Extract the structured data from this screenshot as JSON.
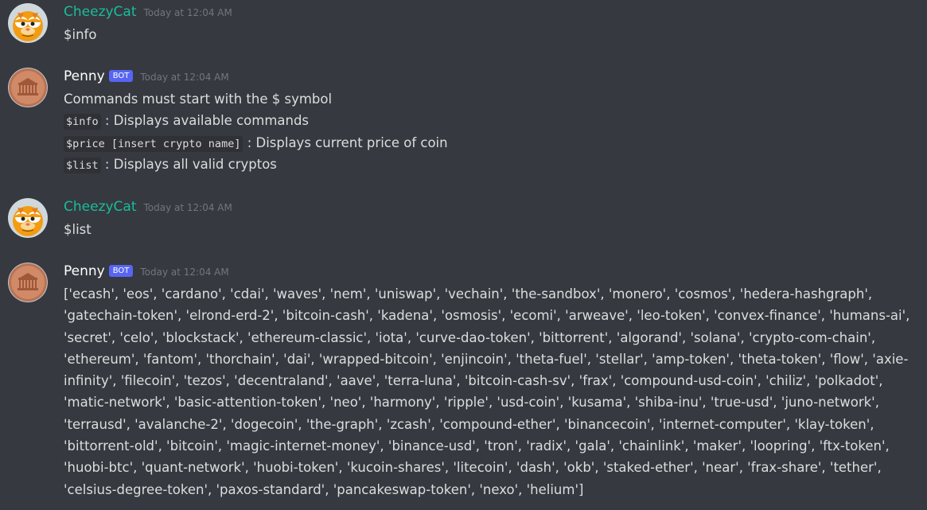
{
  "messages": [
    {
      "author": "CheezyCat",
      "timestamp": "Today at 12:04 AM",
      "content": "$info"
    },
    {
      "author": "Penny",
      "bot_tag": "BOT",
      "timestamp": "Today at 12:04 AM",
      "lines": [
        {
          "text": "Commands must start with the $ symbol"
        },
        {
          "code": "$info",
          "text": ": Displays available commands"
        },
        {
          "code": "$price [insert crypto name]",
          "text": ": Displays current price of coin"
        },
        {
          "code": "$list",
          "text": ": Displays all valid cryptos"
        }
      ]
    },
    {
      "author": "CheezyCat",
      "timestamp": "Today at 12:04 AM",
      "content": "$list"
    },
    {
      "author": "Penny",
      "bot_tag": "BOT",
      "timestamp": "Today at 12:04 AM",
      "content": "['ecash', 'eos', 'cardano', 'cdai', 'waves', 'nem', 'uniswap', 'vechain', 'the-sandbox', 'monero', 'cosmos', 'hedera-hashgraph', 'gatechain-token', 'elrond-erd-2', 'bitcoin-cash', 'kadena', 'osmosis', 'ecomi', 'arweave', 'leo-token', 'convex-finance', 'humans-ai', 'secret', 'celo', 'blockstack', 'ethereum-classic', 'iota', 'curve-dao-token', 'bittorrent', 'algorand', 'solana', 'crypto-com-chain', 'ethereum', 'fantom', 'thorchain', 'dai', 'wrapped-bitcoin', 'enjincoin', 'theta-fuel', 'stellar', 'amp-token', 'theta-token', 'flow', 'axie-infinity', 'filecoin', 'tezos', 'decentraland', 'aave', 'terra-luna', 'bitcoin-cash-sv', 'frax', 'compound-usd-coin', 'chiliz', 'polkadot', 'matic-network', 'basic-attention-token', 'neo', 'harmony', 'ripple', 'usd-coin', 'kusama', 'shiba-inu', 'true-usd', 'juno-network', 'terrausd', 'avalanche-2', 'dogecoin', 'the-graph', 'zcash', 'compound-ether', 'binancecoin', 'internet-computer', 'klay-token', 'bittorrent-old', 'bitcoin', 'magic-internet-money', 'binance-usd', 'tron', 'radix', 'gala', 'chainlink', 'maker', 'loopring', 'ftx-token', 'huobi-btc', 'quant-network', 'huobi-token', 'kucoin-shares', 'litecoin', 'dash', 'okb', 'staked-ether', 'near', 'frax-share', 'tether', 'celsius-degree-token', 'paxos-standard', 'pancakeswap-token', 'nexo', 'helium']"
    }
  ],
  "icons": {
    "cat_avatar": "garfield-avatar-icon",
    "bot_avatar": "penny-coin-avatar-icon"
  },
  "colors": {
    "background": "#36393f",
    "cat_username": "#1abc9c",
    "bot_username": "#ffffff",
    "bot_tag": "#5865f2",
    "timestamp": "#72767d",
    "text": "#dcddde"
  }
}
